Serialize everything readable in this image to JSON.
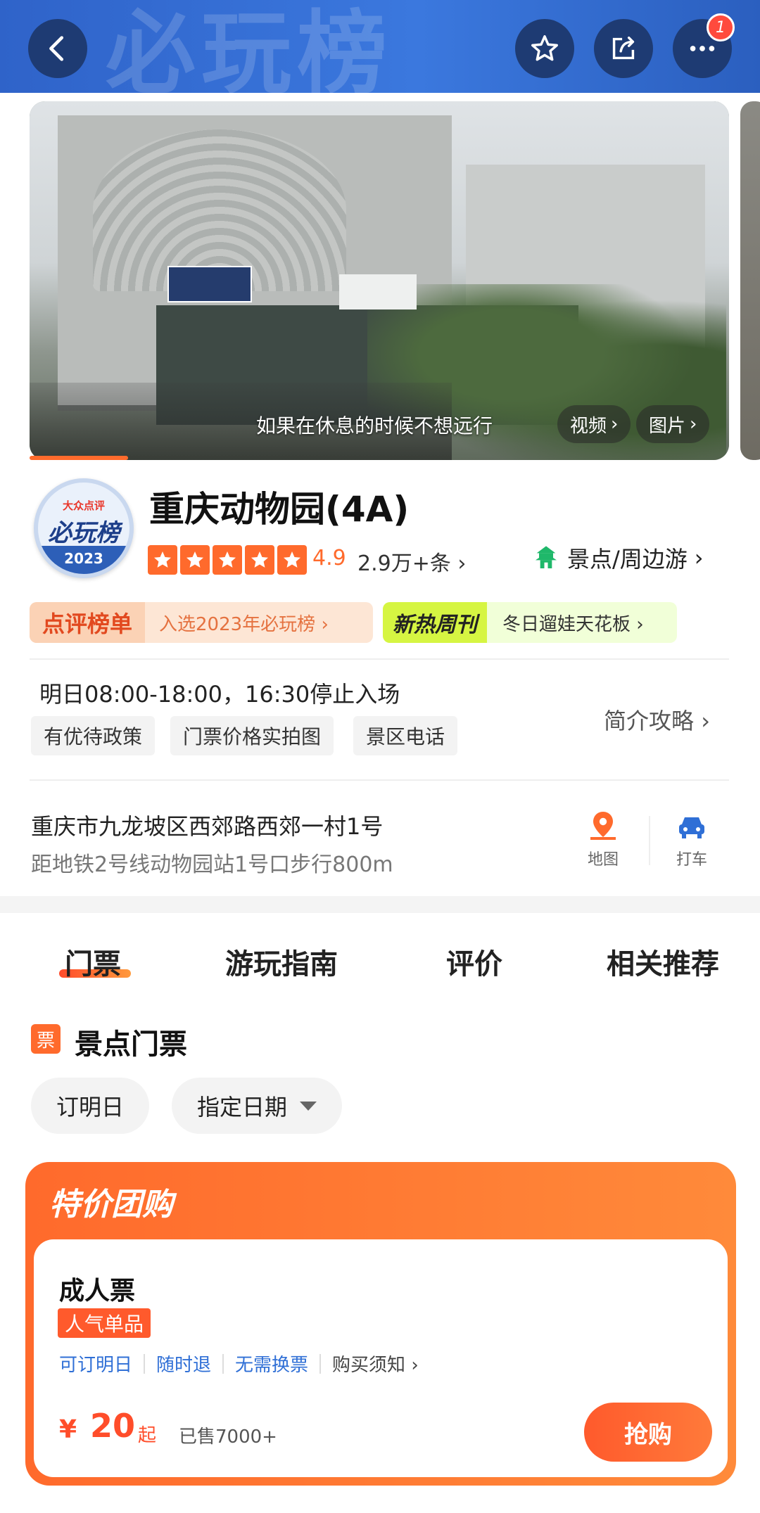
{
  "header": {
    "watermark": "必玩榜",
    "icons": {
      "back": "back-arrow-icon",
      "favorite": "star-icon",
      "share": "share-icon",
      "more": "more-icon"
    },
    "more_badge": "1"
  },
  "hero": {
    "caption": "如果在休息的时候不想远行",
    "video_label": "视频",
    "photo_label": "图片"
  },
  "logo": {
    "line1": "大众点评",
    "line2": "必玩榜",
    "year": "2023"
  },
  "place": {
    "title": "重庆动物园(4A)",
    "rating": "4.9",
    "reviews": "2.9万+条",
    "category": "景点/周边游",
    "rating_stars": 5
  },
  "banners": {
    "rank_tag": "点评榜单",
    "rank_text": "入选2023年必玩榜",
    "weekly_tag": "新热周刊",
    "weekly_text": "冬日遛娃天花板"
  },
  "info": {
    "hours": "明日08:00-18:00，16:30停止入场",
    "chips": [
      "有优待政策",
      "门票价格实拍图",
      "景区电话"
    ],
    "guide": "简介攻略"
  },
  "address": {
    "line": "重庆市九龙坡区西郊路西郊一村1号",
    "metro": "距地铁2号线动物园站1号口步行800m",
    "map_label": "地图",
    "taxi_label": "打车"
  },
  "tabs": [
    "门票",
    "游玩指南",
    "评价",
    "相关推荐"
  ],
  "tickets": {
    "section_icon": "票",
    "section_title": "景点门票",
    "date_options": [
      "订明日",
      "指定日期"
    ]
  },
  "deal": {
    "title": "特价团购",
    "product": "成人票",
    "hot_tag": "人气单品",
    "features": [
      "可订明日",
      "随时退",
      "无需换票"
    ],
    "notice": "购买须知",
    "currency": "¥",
    "price": "20",
    "price_suffix": "起",
    "sold": "已售7000+",
    "buy_label": "抢购"
  },
  "colors": {
    "brand_blue": "#2f63c9",
    "accent_orange": "#ff6a2c",
    "link_blue": "#2f6fd6"
  }
}
